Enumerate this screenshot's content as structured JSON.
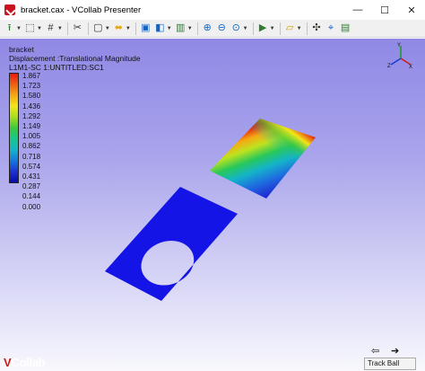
{
  "window": {
    "title": "bracket.cax - VCollab Presenter",
    "minimize": "—",
    "maximize": "☐",
    "close": "✕"
  },
  "toolbar": {
    "buttons": [
      {
        "name": "import-model-icon",
        "glyph": "⭱",
        "color": "#2e7d32",
        "dropdown": true
      },
      {
        "name": "fit-view-icon",
        "glyph": "⬚",
        "color": "#333333",
        "dropdown": true
      },
      {
        "name": "grid-icon",
        "glyph": "#",
        "color": "#333333",
        "dropdown": true
      },
      {
        "name": "scissors-icon",
        "glyph": "✂",
        "color": "#333333",
        "dropdown": false
      },
      {
        "name": "selection-icon",
        "glyph": "▢",
        "color": "#333333",
        "dropdown": true
      },
      {
        "name": "probe-icon",
        "glyph": "⬌",
        "color": "#e6a817",
        "dropdown": true
      },
      {
        "name": "camera-icon",
        "glyph": "▣",
        "color": "#1565c0",
        "dropdown": false
      },
      {
        "name": "annotation-icon",
        "glyph": "◧",
        "color": "#1565c0",
        "dropdown": true
      },
      {
        "name": "scalar-bar-icon",
        "glyph": "▥",
        "color": "#2e7d32",
        "dropdown": true
      },
      {
        "name": "zoom-in-icon",
        "glyph": "⊕",
        "color": "#1565c0",
        "dropdown": false
      },
      {
        "name": "zoom-out-icon",
        "glyph": "⊖",
        "color": "#1565c0",
        "dropdown": false
      },
      {
        "name": "zoom-area-icon",
        "glyph": "⊙",
        "color": "#1565c0",
        "dropdown": true
      },
      {
        "name": "play-icon",
        "glyph": "▶",
        "color": "#2e7d32",
        "dropdown": true
      },
      {
        "name": "view-box-icon",
        "glyph": "▱",
        "color": "#c9a400",
        "dropdown": true
      },
      {
        "name": "center-icon",
        "glyph": "✣",
        "color": "#333333",
        "dropdown": false
      },
      {
        "name": "zoom-fit-icon",
        "glyph": "⌖",
        "color": "#1565c0",
        "dropdown": false
      },
      {
        "name": "settings-icon",
        "glyph": "▤",
        "color": "#2e7d32",
        "dropdown": false
      }
    ]
  },
  "viewport": {
    "model_name": "bracket",
    "result_label": "Displacement :Translational Magnitude",
    "step_label": "L1M1-SC 1:UNTITLED:SC1",
    "axis": {
      "x": "X",
      "y": "Y",
      "z": "Z"
    }
  },
  "legend": {
    "values": [
      "1.867",
      "1.723",
      "1.580",
      "1.436",
      "1.292",
      "1.149",
      "1.005",
      "0.862",
      "0.718",
      "0.574",
      "0.431",
      "0.287",
      "0.144",
      "0.000"
    ],
    "colors": [
      "#e61a0f",
      "#f5aa14",
      "#f2e619",
      "#3cc83c",
      "#14b4c8",
      "#1e32d2",
      "#0a0aaa"
    ]
  },
  "footer": {
    "prev_arrow": "⇦",
    "next_arrow": "➔",
    "logo_v": "V",
    "logo_rest": "Collab",
    "status": "Track Ball"
  }
}
